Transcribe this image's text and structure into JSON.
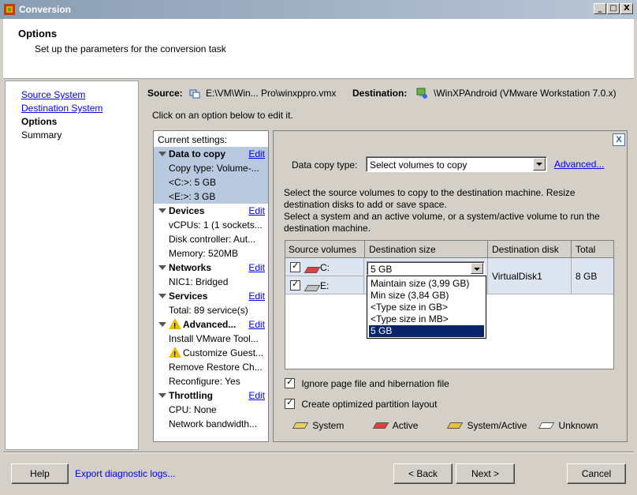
{
  "window": {
    "title": "Conversion",
    "controls": {
      "minimize": "_",
      "maximize": "□",
      "close": "X"
    }
  },
  "header": {
    "title": "Options",
    "subtitle": "Set up the parameters for the conversion task"
  },
  "nav": {
    "items": [
      {
        "label": "Source System",
        "state": "link"
      },
      {
        "label": "Destination System",
        "state": "link"
      },
      {
        "label": "Options",
        "state": "current"
      },
      {
        "label": "Summary",
        "state": "plain"
      }
    ]
  },
  "source_bar": {
    "source_label": "Source:",
    "source_value": "E:\\VM\\Win... Pro\\winxppro.vmx",
    "destination_label": "Destination:",
    "destination_value": "\\WinXPAndroid (VMware Workstation 7.0.x)"
  },
  "instruction": "Click on an option below to edit it.",
  "settings": {
    "header": "Current settings:",
    "edit_label": "Edit",
    "groups": [
      {
        "title": "Data to copy",
        "items": [
          "Copy type: Volume-...",
          "<C:>: 5 GB",
          "<E:>: 3 GB"
        ]
      },
      {
        "title": "Devices",
        "items": [
          "vCPUs: 1 (1 sockets...",
          "Disk controller: Aut...",
          "Memory: 520MB"
        ]
      },
      {
        "title": "Networks",
        "items": [
          "NIC1: Bridged"
        ]
      },
      {
        "title": "Services",
        "items": [
          "Total: 89 service(s)"
        ]
      },
      {
        "title": "Advanced...",
        "items": [
          "Install VMware Tool...",
          "Customize Guest...",
          "Remove Restore Ch...",
          "Reconfigure: Yes"
        ]
      },
      {
        "title": "Throttling",
        "items": [
          "CPU: None",
          "Network bandwidth..."
        ]
      }
    ]
  },
  "panel": {
    "close": "X",
    "data_copy_type_label": "Data copy type:",
    "data_copy_type_value": "Select volumes to copy",
    "advanced_link": "Advanced...",
    "description_1": "Select the source volumes to copy to the destination machine. Resize destination disks to add or save space.",
    "description_2": "Select a system and an active volume, or a system/active volume to run the destination machine.",
    "table": {
      "columns": [
        "Source volumes",
        "Destination size",
        "Destination disk",
        "Total"
      ],
      "rows": [
        {
          "volume": "C:",
          "size": "5 GB",
          "disk": "VirtualDisk1",
          "total": "8 GB"
        },
        {
          "volume": "E:",
          "size": "",
          "disk": "",
          "total": ""
        }
      ],
      "dropdown_options": [
        "Maintain size (3,99 GB)",
        "Min size (3,84 GB)",
        "<Type size in GB>",
        "<Type size in MB>",
        "5 GB"
      ],
      "selected_option": "5 GB"
    },
    "ignore_pagefile": "Ignore page file and hibernation file",
    "optimized_layout": "Create optimized partition layout",
    "legend": {
      "system": "System",
      "active": "Active",
      "system_active": "System/Active",
      "unknown": "Unknown"
    },
    "colors": {
      "system": "#e8d060",
      "active": "#e04040",
      "system_active": "#e8c040",
      "unknown": "#ffffff"
    }
  },
  "footer": {
    "help": "Help",
    "export": "Export diagnostic logs...",
    "back": "< Back",
    "next": "Next >",
    "cancel": "Cancel"
  }
}
